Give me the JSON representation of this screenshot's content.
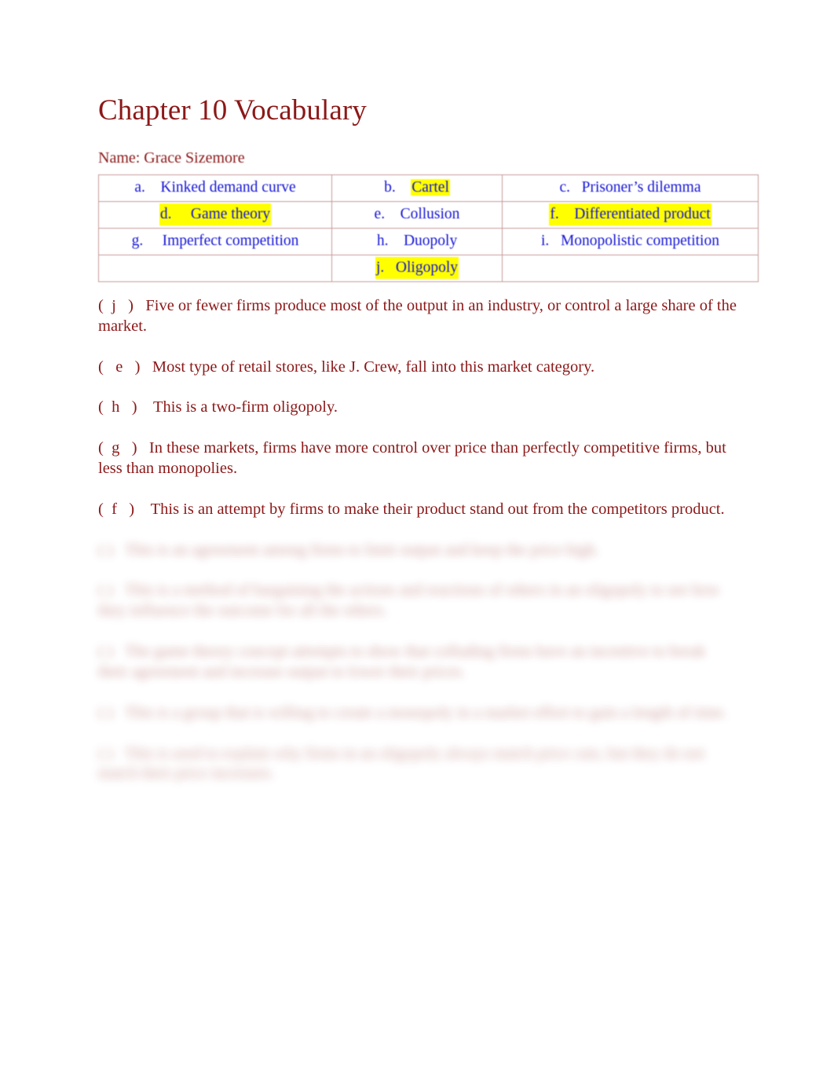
{
  "document": {
    "title": "Chapter 10 Vocabulary",
    "name_line": "Name: Grace Sizemore",
    "colors": {
      "heading_red": "#8c1818",
      "term_blue": "#1414d6",
      "highlight_yellow": "#ffff00",
      "table_border_rose": "#c79a9a",
      "page_background": "#ffffff"
    }
  },
  "vocab_table": {
    "columns": 3,
    "rows": [
      {
        "cells": [
          {
            "letter": "a.",
            "term": "Kinked demand curve",
            "highlighted": false,
            "align": "center"
          },
          {
            "letter": "b.",
            "term": "Cartel",
            "highlighted": true,
            "align": "center"
          },
          {
            "letter": "c.",
            "term": "Prisoner’s dilemma",
            "highlighted": false,
            "align": "center"
          }
        ]
      },
      {
        "cells": [
          {
            "letter": "d.",
            "term": "Game theory",
            "highlighted": true,
            "align": "center"
          },
          {
            "letter": "e.",
            "term": "Collusion",
            "highlighted": false,
            "align": "center"
          },
          {
            "letter": "f.",
            "term": "Differentiated product",
            "highlighted": true,
            "align": "center"
          }
        ]
      },
      {
        "cells": [
          {
            "letter": "g.",
            "term": "Imperfect competition",
            "highlighted": false,
            "align": "center"
          },
          {
            "letter": "h.",
            "term": "Duopoly",
            "highlighted": false,
            "align": "center"
          },
          {
            "letter": "i.",
            "term": "Monopolistic competition",
            "highlighted": false,
            "align": "center"
          }
        ]
      },
      {
        "cells": [
          {
            "letter": "",
            "term": "",
            "highlighted": false,
            "align": "center"
          },
          {
            "letter": "j.",
            "term": "Oligopoly",
            "highlighted": true,
            "align": "center"
          },
          {
            "letter": "",
            "term": "",
            "highlighted": false,
            "align": "center"
          }
        ]
      }
    ],
    "flat_cells": {
      "r0c0_letter": "a.",
      "r0c0_term": "Kinked demand curve",
      "r0c1_letter": "b.",
      "r0c1_term": "Cartel",
      "r0c2_letter": "c.",
      "r0c2_term": "Prisoner’s dilemma",
      "r1c0_letter": "d.",
      "r1c0_term": "Game theory",
      "r1c1_letter": "e.",
      "r1c1_term": "Collusion",
      "r1c2_letter": "f.",
      "r1c2_term": "Differentiated product",
      "r2c0_letter": "g.",
      "r2c0_term": "Imperfect competition",
      "r2c1_letter": "h.",
      "r2c1_term": "Duopoly",
      "r2c2_letter": "i.",
      "r2c2_term": "Monopolistic competition",
      "r3c1_letter": "j.",
      "r3c1_term": "Oligopoly"
    }
  },
  "answers": [
    {
      "marker": "(  j   )",
      "text": "Five or fewer firms produce most of the output in an industry, or control a large share of the market.",
      "legible": true
    },
    {
      "marker": "(   e   )",
      "text": "Most type of retail stores, like J. Crew, fall into this market category.",
      "legible": true
    },
    {
      "marker": "(  h   )",
      "text": "This is a two-firm oligopoly.",
      "legible": true
    },
    {
      "marker": "(  g   )",
      "text": "In these markets, firms have more control over price than perfectly competitive firms, but less than monopolies.",
      "legible": true
    },
    {
      "marker": "(  f   )",
      "text": "This is an attempt by firms to make their product stand out from the competitors product.",
      "legible": true
    }
  ],
  "blurred_answers": [
    {
      "marker": "(      )",
      "text": "This is an agreement among firms to limit output and keep the price high.",
      "legible": false
    },
    {
      "marker": "(      )",
      "text": "This is a method of bargaining the actions and reactions of others in an oligopoly to see how they influence the outcome for all the others.",
      "legible": false
    },
    {
      "marker": "(      )",
      "text": "The game theory concept attempts to show that colluding firms have an incentive to break their agreement and increase output to lower their prices.",
      "legible": false
    },
    {
      "marker": "(      )",
      "text": "This is a group that is willing to create a monopoly in a market effort to gain a length of time.",
      "legible": false
    },
    {
      "marker": "(      )",
      "text": "This is used to explain why firms in an oligopoly always match price cuts, but they do not match their price increases.",
      "legible": false
    }
  ]
}
